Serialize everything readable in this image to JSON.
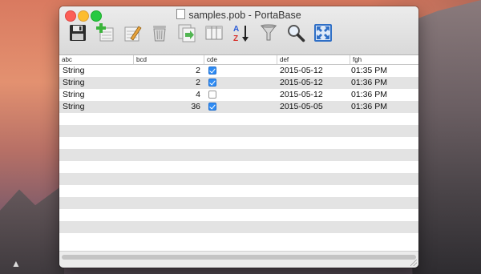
{
  "window": {
    "title": "samples.pob - PortaBase"
  },
  "toolbar": {
    "buttons": [
      {
        "icon": "save-icon"
      },
      {
        "icon": "add-row-icon"
      },
      {
        "icon": "edit-row-icon"
      },
      {
        "icon": "delete-trash-icon"
      },
      {
        "icon": "copy-row-icon"
      },
      {
        "icon": "columns-icon"
      },
      {
        "icon": "sort-az-icon"
      },
      {
        "icon": "filter-funnel-icon"
      },
      {
        "icon": "search-magnifier-icon"
      },
      {
        "icon": "fullscreen-icon"
      }
    ]
  },
  "table": {
    "headers": [
      "abc",
      "bcd",
      "cde",
      "def",
      "fgh"
    ],
    "rows": [
      {
        "abc": "String",
        "bcd": "2",
        "cde": true,
        "def": "2015-05-12",
        "fgh": "01:35 PM"
      },
      {
        "abc": "String",
        "bcd": "2",
        "cde": true,
        "def": "2015-05-12",
        "fgh": "01:36 PM"
      },
      {
        "abc": "String",
        "bcd": "4",
        "cde": false,
        "def": "2015-05-12",
        "fgh": "01:36 PM"
      },
      {
        "abc": "String",
        "bcd": "36",
        "cde": true,
        "def": "2015-05-05",
        "fgh": "01:36 PM"
      }
    ]
  },
  "colors": {
    "checkbox_accent": "#2f8cf4",
    "row_alternate": "#e3e3e3"
  }
}
